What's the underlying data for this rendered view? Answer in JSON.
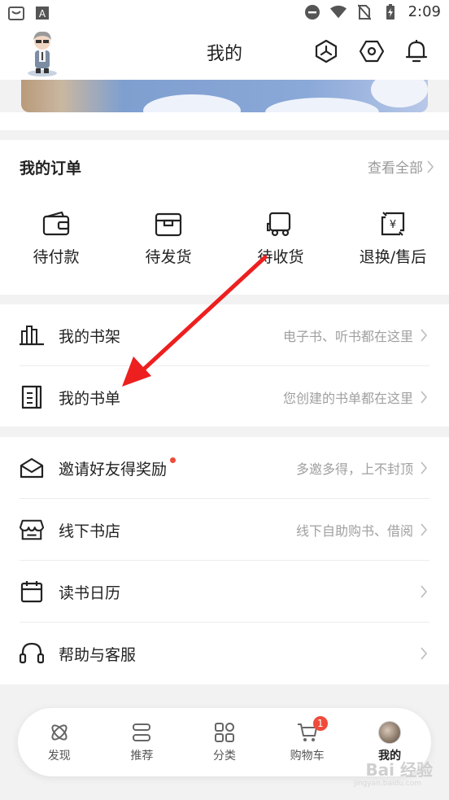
{
  "status_bar": {
    "time": "2:09"
  },
  "header": {
    "title": "我的"
  },
  "orders": {
    "title": "我的订单",
    "view_all": "查看全部",
    "items": [
      {
        "label": "待付款",
        "icon": "wallet-icon"
      },
      {
        "label": "待发货",
        "icon": "package-icon"
      },
      {
        "label": "待收货",
        "icon": "truck-icon"
      },
      {
        "label": "退换/售后",
        "icon": "refund-icon"
      }
    ]
  },
  "shelf_section": [
    {
      "label": "我的书架",
      "hint": "电子书、听书都在这里",
      "icon": "bookshelf-icon"
    },
    {
      "label": "我的书单",
      "hint": "您创建的书单都在这里",
      "icon": "booklist-icon"
    }
  ],
  "service_section": [
    {
      "label": "邀请好友得奖励",
      "hint": "多邀多得，上不封顶",
      "icon": "invite-icon"
    },
    {
      "label": "线下书店",
      "hint": "线下自助购书、借阅",
      "icon": "store-icon"
    },
    {
      "label": "读书日历",
      "hint": "",
      "icon": "calendar-icon"
    },
    {
      "label": "帮助与客服",
      "hint": "",
      "icon": "headset-icon"
    }
  ],
  "bottom_nav": [
    {
      "label": "发现",
      "icon": "discover-icon"
    },
    {
      "label": "推荐",
      "icon": "recommend-icon"
    },
    {
      "label": "分类",
      "icon": "category-icon"
    },
    {
      "label": "购物车",
      "icon": "cart-icon",
      "badge": "1"
    },
    {
      "label": "我的",
      "icon": "profile-avatar-icon",
      "active": true
    }
  ],
  "watermark": {
    "text": "Bai 经验",
    "sub": "jingyan.baidu.com"
  },
  "colors": {
    "accent_red": "#f04a3a",
    "annotation_arrow": "#ee1f1f"
  }
}
